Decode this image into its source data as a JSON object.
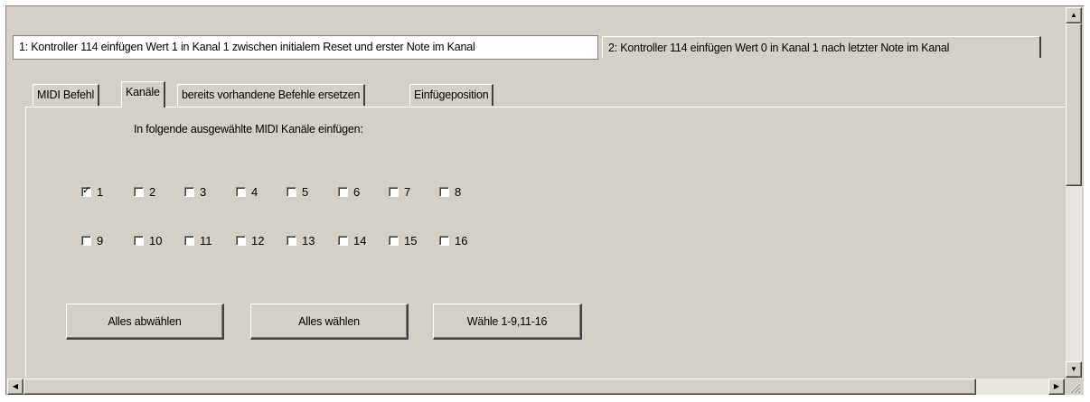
{
  "top_tabs": [
    {
      "label": "1: Kontroller 114 einfügen Wert 1 in Kanal 1 zwischen initialem Reset und erster Note im Kanal",
      "active": true
    },
    {
      "label": "2: Kontroller 114 einfügen Wert 0 in Kanal 1 nach letzter Note im Kanal",
      "active": false
    }
  ],
  "inner_tabs": [
    {
      "label": "MIDI Befehl"
    },
    {
      "label": "Kanäle",
      "active": true
    },
    {
      "label": "bereits vorhandene Befehle ersetzen"
    },
    {
      "label": "Einfügeposition"
    }
  ],
  "instruction": "In folgende ausgewählte MIDI Kanäle einfügen:",
  "channels": [
    {
      "label": "1",
      "checked": true
    },
    {
      "label": "2",
      "checked": false
    },
    {
      "label": "3",
      "checked": false
    },
    {
      "label": "4",
      "checked": false
    },
    {
      "label": "5",
      "checked": false
    },
    {
      "label": "6",
      "checked": false
    },
    {
      "label": "7",
      "checked": false
    },
    {
      "label": "8",
      "checked": false
    },
    {
      "label": "9",
      "checked": false
    },
    {
      "label": "10",
      "checked": false
    },
    {
      "label": "11",
      "checked": false
    },
    {
      "label": "12",
      "checked": false
    },
    {
      "label": "13",
      "checked": false
    },
    {
      "label": "14",
      "checked": false
    },
    {
      "label": "15",
      "checked": false
    },
    {
      "label": "16",
      "checked": false
    }
  ],
  "buttons": {
    "deselect_all": "Alles abwählen",
    "select_all": "Alles wählen",
    "select_range": "Wähle 1-9,11-16"
  },
  "scrollbars": {
    "up_arrow": "▲",
    "down_arrow": "▼",
    "left_arrow": "◀",
    "right_arrow": "▶"
  },
  "colors": {
    "face": "#d4d0c8",
    "highlight": "#ffffff",
    "shadow": "#808080",
    "dark_shadow": "#404040"
  }
}
